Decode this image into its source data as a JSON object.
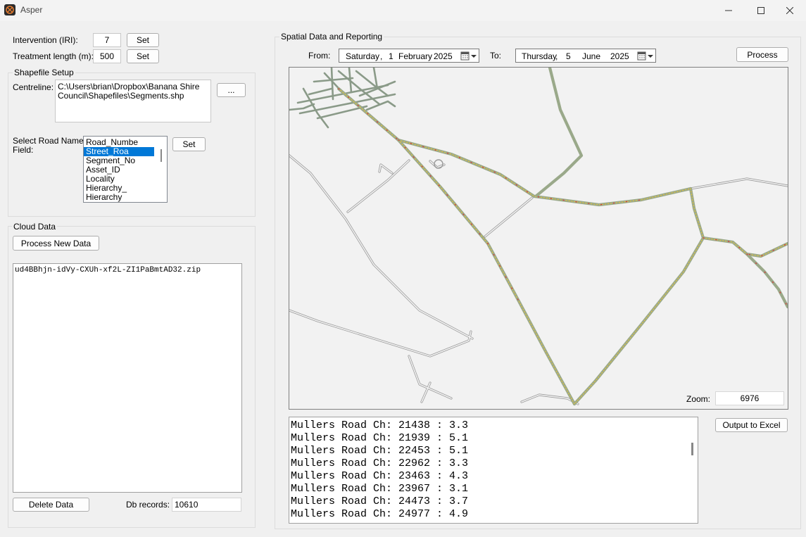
{
  "window": {
    "title": "Asper"
  },
  "intervention": {
    "label": "Intervention (IRI):",
    "value": "7",
    "set_label": "Set"
  },
  "treatment": {
    "label": "Treatment length (m):",
    "value": "500",
    "set_label": "Set"
  },
  "shapefile": {
    "group_label": "Shapefile Setup",
    "centreline_label": "Centreline:",
    "centreline_path_line1": "C:\\Users\\brian\\Dropbox\\Banana Shire",
    "centreline_path_line2": "Council\\Shapefiles\\Segments.shp",
    "browse_label": "...",
    "road_field_label_line1": "Select Road Name",
    "road_field_label_line2": "Field:",
    "fields": [
      "Road_Numbe",
      "Street_Roa",
      "Segment_No",
      "Asset_ID",
      "Locality",
      "Hierarchy_",
      "Hierarchy"
    ],
    "selected_field": "Street_Roa",
    "set_label": "Set"
  },
  "cloud": {
    "group_label": "Cloud Data",
    "process_new_label": "Process New Data",
    "files": [
      "ud4BBhjn-idVy-CXUh-xf2L-ZI1PaBmtAD32.zip"
    ],
    "delete_label": "Delete Data",
    "db_records_label": "Db records:",
    "db_records_value": "10610"
  },
  "spatial": {
    "group_label": "Spatial Data and Reporting",
    "from_label": "From:",
    "from_date": {
      "weekday": "Saturday",
      "day": "1",
      "month": "February",
      "year": "2025"
    },
    "to_label": "To:",
    "to_date": {
      "weekday": "Thursday",
      "day": "5",
      "month": "June",
      "year": "2025"
    },
    "process_label": "Process",
    "zoom_label": "Zoom:",
    "zoom_value": "6976",
    "output_label": "Output to Excel",
    "report_lines": [
      "Mullers Road Ch: 21438 : 3.3",
      "Mullers Road Ch: 21939 : 5.1",
      "Mullers Road Ch: 22453 : 5.1",
      "Mullers Road Ch: 22962 : 3.3",
      "Mullers Road Ch: 23463 : 4.3",
      "Mullers Road Ch: 23967 : 3.1",
      "Mullers Road Ch: 24473 : 3.7",
      "Mullers Road Ch: 24977 : 4.9"
    ]
  },
  "colors": {
    "selection": "#0078d7",
    "road_base": "#b8b8b8",
    "road_surveyed": "#9aa98a",
    "iri_high": "#d23c3c",
    "iri_mid": "#e8c43a"
  }
}
